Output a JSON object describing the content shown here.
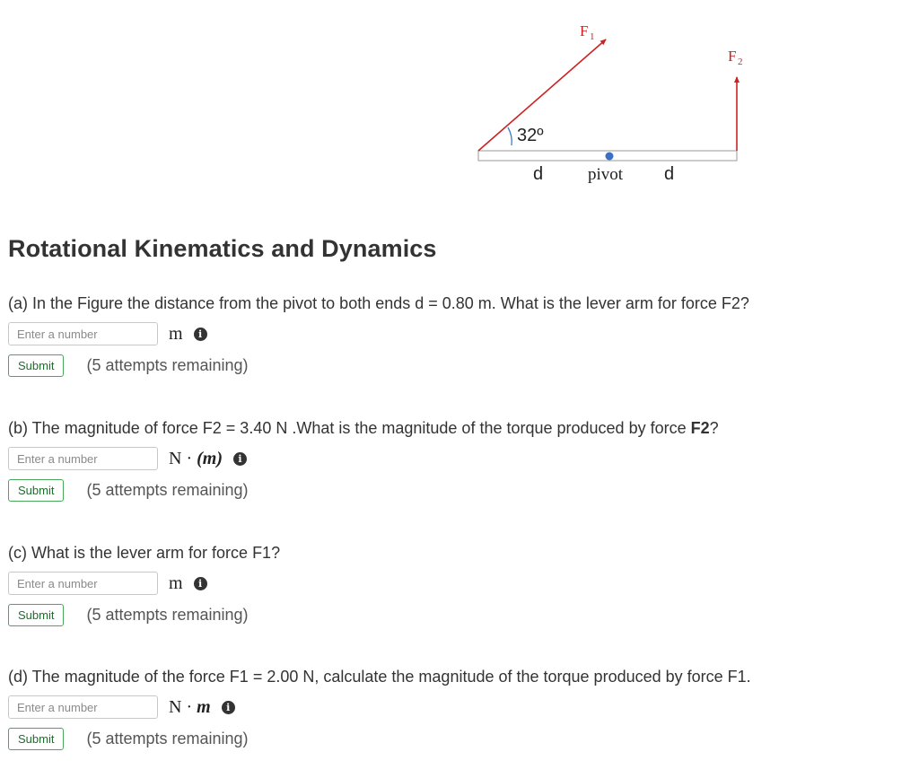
{
  "figure": {
    "angle_label": "32º",
    "f1_label": "F1",
    "f2_label": "F2",
    "pivot_label": "pivot",
    "d_left_label": "d",
    "d_right_label": "d",
    "colors": {
      "force": "#cc2222",
      "angle_arc": "#3a7bc8",
      "pivot_dot": "#3a6fc4",
      "beam": "#999999"
    }
  },
  "title": "Rotational Kinematics and Dynamics",
  "questions": [
    {
      "text": "(a) In the Figure the distance from the pivot to both ends d = 0.80 m. What is the lever arm for force F2?",
      "placeholder": "Enter a number",
      "unit": "m",
      "submit_label": "Submit",
      "attempts": "(5 attempts remaining)"
    },
    {
      "text_before": "(b) The magnitude of force F2 = 3.40 N .What is the magnitude of the torque produced by force ",
      "text_bold": "F2",
      "text_after": "?",
      "placeholder": "Enter a number",
      "unit_n": "N",
      "unit_dot": "·",
      "unit_m": "(m)",
      "submit_label": "Submit",
      "attempts": "(5 attempts remaining)"
    },
    {
      "text": "(c) What is the lever arm for force F1?",
      "placeholder": "Enter a number",
      "unit": "m",
      "submit_label": "Submit",
      "attempts": "(5 attempts remaining)"
    },
    {
      "text": "(d) The magnitude of the force F1 = 2.00 N, calculate the magnitude of the torque produced by force F1.",
      "placeholder": "Enter a number",
      "unit_n": "N",
      "unit_dot": "·",
      "unit_m": "m",
      "submit_label": "Submit",
      "attempts": "(5 attempts remaining)"
    }
  ],
  "info_icon": "info-circle-icon"
}
